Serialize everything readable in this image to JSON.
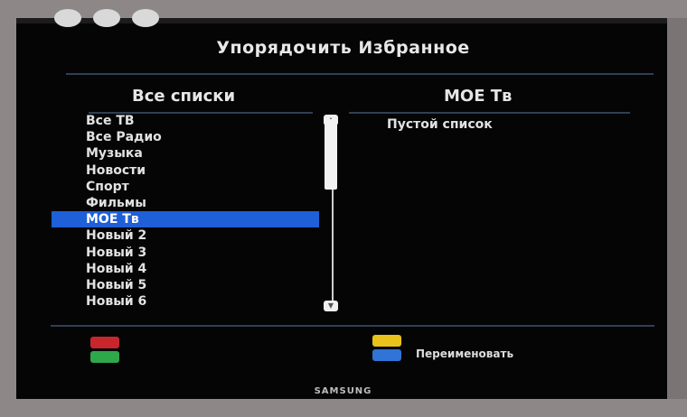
{
  "title": "Упорядочить Избранное",
  "left_panel": {
    "header": "Все списки",
    "items": [
      {
        "label": "Все ТВ"
      },
      {
        "label": "Все Радио"
      },
      {
        "label": "Музыка"
      },
      {
        "label": "Новости"
      },
      {
        "label": "Спорт"
      },
      {
        "label": "Фильмы"
      },
      {
        "label": "МОЕ Тв"
      },
      {
        "label": "Новый 2"
      },
      {
        "label": "Новый 3"
      },
      {
        "label": "Новый 4"
      },
      {
        "label": "Новый 5"
      },
      {
        "label": "Новый 6"
      }
    ],
    "selected_label": "МОЕ Тв"
  },
  "right_panel": {
    "header": "МОЕ Тв",
    "empty_text": "Пустой список"
  },
  "footer": {
    "yellow_blue_hint": "Переименовать",
    "red_green_icon": "red-green-key-icon",
    "yellow_blue_icon": "yellow-blue-key-icon"
  },
  "brand": "SAMSUNG",
  "colors": {
    "selection": "#1f5fd8",
    "red": "#c8262c",
    "green": "#2ea84a",
    "yellow": "#e9c21b",
    "blue": "#2f74d6"
  }
}
